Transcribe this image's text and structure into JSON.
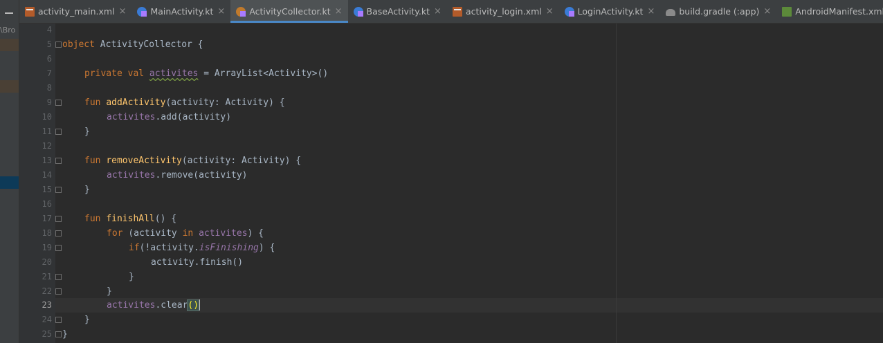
{
  "sidebar": {
    "path_fragment": "\\Bro"
  },
  "tabs": [
    {
      "label": "activity_main.xml",
      "icon": "xml-file-icon",
      "active": false
    },
    {
      "label": "MainActivity.kt",
      "icon": "kotlin-class-icon",
      "active": false
    },
    {
      "label": "ActivityCollector.kt",
      "icon": "kotlin-object-icon",
      "active": true
    },
    {
      "label": "BaseActivity.kt",
      "icon": "kotlin-class-icon",
      "active": false
    },
    {
      "label": "activity_login.xml",
      "icon": "xml-file-icon",
      "active": false
    },
    {
      "label": "LoginActivity.kt",
      "icon": "kotlin-class-icon",
      "active": false
    },
    {
      "label": "build.gradle (:app)",
      "icon": "gradle-icon",
      "active": false
    },
    {
      "label": "AndroidManifest.xml",
      "icon": "manifest-icon",
      "active": false
    }
  ],
  "tab_close_glyph": "×",
  "editor": {
    "current_line": 23,
    "lines": [
      {
        "n": "4"
      },
      {
        "n": "5",
        "t1": "object",
        "t2": " ActivityCollector {"
      },
      {
        "n": "6"
      },
      {
        "n": "7",
        "a": "private val ",
        "b": "activites",
        "c": " = ArrayList<Activity>()"
      },
      {
        "n": "8"
      },
      {
        "n": "9",
        "a": "fun ",
        "b": "addActivity",
        "c": "(activity: Activity) {"
      },
      {
        "n": "10",
        "a": "activites",
        "b": ".add(activity)"
      },
      {
        "n": "11",
        "a": "}"
      },
      {
        "n": "12"
      },
      {
        "n": "13",
        "a": "fun ",
        "b": "removeActivity",
        "c": "(activity: Activity) {"
      },
      {
        "n": "14",
        "a": "activites",
        "b": ".remove(activity)"
      },
      {
        "n": "15",
        "a": "}"
      },
      {
        "n": "16"
      },
      {
        "n": "17",
        "a": "fun ",
        "b": "finishAll",
        "c": "() {"
      },
      {
        "n": "18",
        "a": "for ",
        "b": "(activity ",
        "c": "in ",
        "d": "activites",
        "e": ") {"
      },
      {
        "n": "19",
        "a": "if",
        "b": "(!activity.",
        "c": "isFinishing",
        "d": ") {"
      },
      {
        "n": "20",
        "a": "activity.finish()"
      },
      {
        "n": "21",
        "a": "}"
      },
      {
        "n": "22",
        "a": "}"
      },
      {
        "n": "23",
        "a": "activites",
        "b": ".clear",
        "c": "()"
      },
      {
        "n": "24",
        "a": "}"
      },
      {
        "n": "25",
        "a": "}"
      }
    ]
  }
}
